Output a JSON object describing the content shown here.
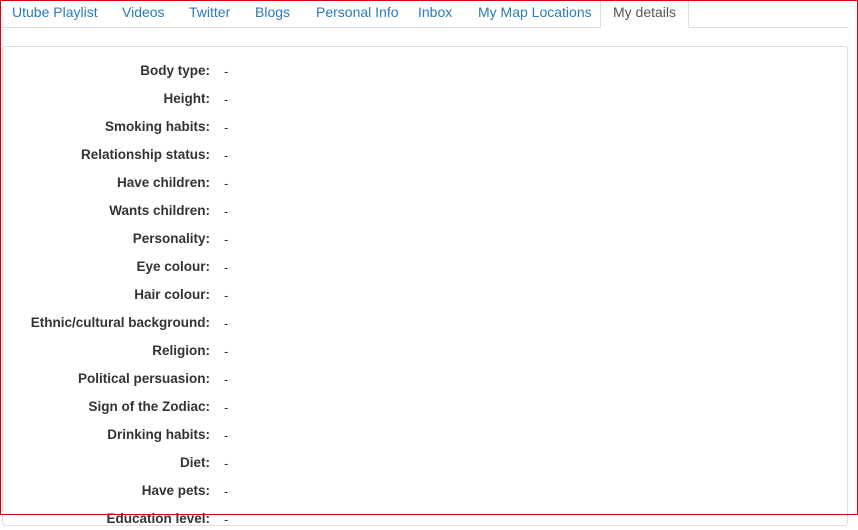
{
  "tabs": [
    {
      "label": "Utube Playlist",
      "active": false
    },
    {
      "label": "Videos",
      "active": false
    },
    {
      "label": "Twitter",
      "active": false
    },
    {
      "label": "Blogs",
      "active": false
    },
    {
      "label": "Personal Info",
      "active": false
    },
    {
      "label": "Inbox",
      "active": false
    },
    {
      "label": "My Map Locations",
      "active": false
    },
    {
      "label": "My details",
      "active": true
    }
  ],
  "details": [
    {
      "label": "Body type:",
      "value": "-"
    },
    {
      "label": "Height:",
      "value": "-"
    },
    {
      "label": "Smoking habits:",
      "value": "-"
    },
    {
      "label": "Relationship status:",
      "value": "-"
    },
    {
      "label": "Have children:",
      "value": "-"
    },
    {
      "label": "Wants children:",
      "value": "-"
    },
    {
      "label": "Personality:",
      "value": "-"
    },
    {
      "label": "Eye colour:",
      "value": "-"
    },
    {
      "label": "Hair colour:",
      "value": "-"
    },
    {
      "label": "Ethnic/cultural background:",
      "value": "-"
    },
    {
      "label": "Religion:",
      "value": "-"
    },
    {
      "label": "Political persuasion:",
      "value": "-"
    },
    {
      "label": "Sign of the Zodiac:",
      "value": "-"
    },
    {
      "label": "Drinking habits:",
      "value": "-"
    },
    {
      "label": "Diet:",
      "value": "-"
    },
    {
      "label": "Have pets:",
      "value": "-"
    },
    {
      "label": "Education level:",
      "value": "-"
    }
  ],
  "colors": {
    "link": "#2a7bb7",
    "frame": "#d6000e",
    "border": "#dddddd",
    "text": "#333333"
  }
}
